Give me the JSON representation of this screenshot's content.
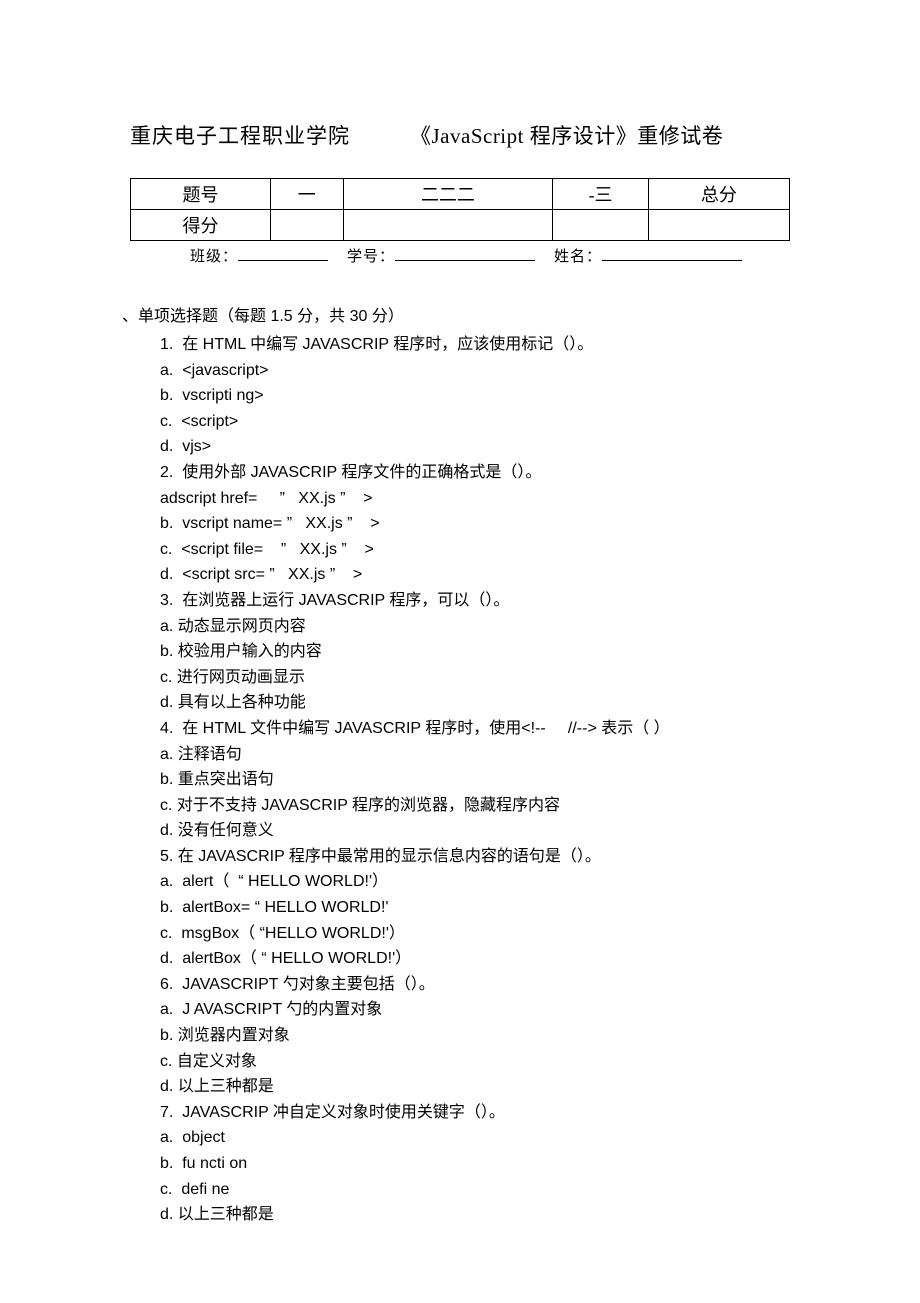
{
  "header": {
    "school": "重庆电子工程职业学院",
    "course": "《JavaScript 程序设计》重修试卷"
  },
  "table": {
    "row1_label": "题号",
    "row1_c1": "一",
    "row1_c2": "二二二",
    "row1_c3": "-三",
    "row1_c4": "总分",
    "row2_label": "得分"
  },
  "info": {
    "class_label": "班级：",
    "id_label": "学号：",
    "name_label": "姓名："
  },
  "section": {
    "heading": "、单项选择题（每题 1.5 分，共 30 分）"
  },
  "lines": [
    "1.  在 HTML 中编写 JAVASCRIP 程序时，应该使用标记（）。",
    "a.  <javascript>",
    "b.  vscripti ng>",
    "c.  <script>",
    "d.  vjs>",
    "2.  使用外部 JAVASCRIP 程序文件的正确格式是（）。",
    "adscript href=     ”   XX.js ”    >",
    "b.  vscript name= ”   XX.js ”    >",
    "c.  <script file=    ”   XX.js ”    >",
    "d.  <script src= ”   XX.js ”    >",
    "3.  在浏览器上运行 JAVASCRIP 程序，可以（）。",
    "a. 动态显示网页内容",
    "b. 校验用户输入的内容",
    "c. 进行网页动画显示",
    "d. 具有以上各种功能",
    "4.  在 HTML 文件中编写 JAVASCRIP 程序时，使用<!--     //--> 表示（ ）",
    "a. 注释语句",
    "b. 重点突出语句",
    "c. 对于不支持 JAVASCRIP 程序的浏览器，隐藏程序内容",
    "d. 没有任何意义",
    "5. 在 JAVASCRIP 程序中最常用的显示信息内容的语句是（）。",
    "a.  alert（  “ HELLO WORLD!'）",
    "b.  alertBox= “ HELLO WORLD!'",
    "c.  msgBox（ “HELLO WORLD!'）",
    "d.  alertBox（ “ HELLO WORLD!'）",
    "6.  JAVASCRIPT 勺对象主要包括（）。",
    "a.  J AVASCRIPT 勺的内置对象",
    "b. 浏览器内置对象",
    "c. 自定义对象",
    "d. 以上三种都是",
    "7.  JAVASCRIP 冲自定义对象时使用关键字（）。",
    "a.  object",
    "b.  fu ncti on",
    "c.  defi ne",
    "d. 以上三种都是"
  ]
}
